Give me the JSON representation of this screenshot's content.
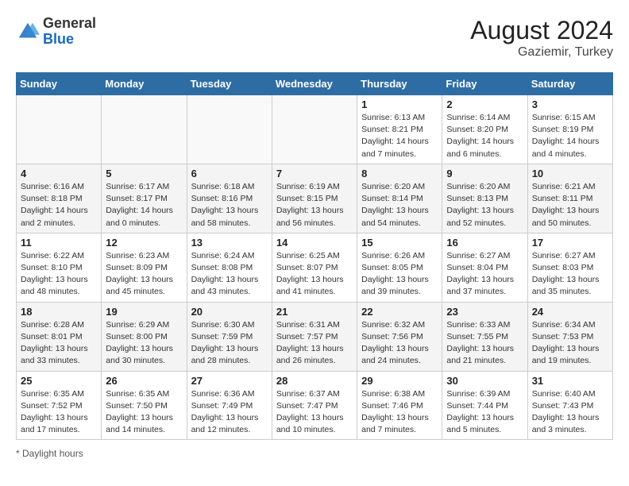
{
  "header": {
    "logo_line1": "General",
    "logo_line2": "Blue",
    "month_year": "August 2024",
    "location": "Gaziemir, Turkey"
  },
  "days_of_week": [
    "Sunday",
    "Monday",
    "Tuesday",
    "Wednesday",
    "Thursday",
    "Friday",
    "Saturday"
  ],
  "weeks": [
    [
      {
        "day": "",
        "info": ""
      },
      {
        "day": "",
        "info": ""
      },
      {
        "day": "",
        "info": ""
      },
      {
        "day": "",
        "info": ""
      },
      {
        "day": "1",
        "sunrise": "6:13 AM",
        "sunset": "8:21 PM",
        "daylight": "14 hours and 7 minutes."
      },
      {
        "day": "2",
        "sunrise": "6:14 AM",
        "sunset": "8:20 PM",
        "daylight": "14 hours and 6 minutes."
      },
      {
        "day": "3",
        "sunrise": "6:15 AM",
        "sunset": "8:19 PM",
        "daylight": "14 hours and 4 minutes."
      }
    ],
    [
      {
        "day": "4",
        "sunrise": "6:16 AM",
        "sunset": "8:18 PM",
        "daylight": "14 hours and 2 minutes."
      },
      {
        "day": "5",
        "sunrise": "6:17 AM",
        "sunset": "8:17 PM",
        "daylight": "14 hours and 0 minutes."
      },
      {
        "day": "6",
        "sunrise": "6:18 AM",
        "sunset": "8:16 PM",
        "daylight": "13 hours and 58 minutes."
      },
      {
        "day": "7",
        "sunrise": "6:19 AM",
        "sunset": "8:15 PM",
        "daylight": "13 hours and 56 minutes."
      },
      {
        "day": "8",
        "sunrise": "6:20 AM",
        "sunset": "8:14 PM",
        "daylight": "13 hours and 54 minutes."
      },
      {
        "day": "9",
        "sunrise": "6:20 AM",
        "sunset": "8:13 PM",
        "daylight": "13 hours and 52 minutes."
      },
      {
        "day": "10",
        "sunrise": "6:21 AM",
        "sunset": "8:11 PM",
        "daylight": "13 hours and 50 minutes."
      }
    ],
    [
      {
        "day": "11",
        "sunrise": "6:22 AM",
        "sunset": "8:10 PM",
        "daylight": "13 hours and 48 minutes."
      },
      {
        "day": "12",
        "sunrise": "6:23 AM",
        "sunset": "8:09 PM",
        "daylight": "13 hours and 45 minutes."
      },
      {
        "day": "13",
        "sunrise": "6:24 AM",
        "sunset": "8:08 PM",
        "daylight": "13 hours and 43 minutes."
      },
      {
        "day": "14",
        "sunrise": "6:25 AM",
        "sunset": "8:07 PM",
        "daylight": "13 hours and 41 minutes."
      },
      {
        "day": "15",
        "sunrise": "6:26 AM",
        "sunset": "8:05 PM",
        "daylight": "13 hours and 39 minutes."
      },
      {
        "day": "16",
        "sunrise": "6:27 AM",
        "sunset": "8:04 PM",
        "daylight": "13 hours and 37 minutes."
      },
      {
        "day": "17",
        "sunrise": "6:27 AM",
        "sunset": "8:03 PM",
        "daylight": "13 hours and 35 minutes."
      }
    ],
    [
      {
        "day": "18",
        "sunrise": "6:28 AM",
        "sunset": "8:01 PM",
        "daylight": "13 hours and 33 minutes."
      },
      {
        "day": "19",
        "sunrise": "6:29 AM",
        "sunset": "8:00 PM",
        "daylight": "13 hours and 30 minutes."
      },
      {
        "day": "20",
        "sunrise": "6:30 AM",
        "sunset": "7:59 PM",
        "daylight": "13 hours and 28 minutes."
      },
      {
        "day": "21",
        "sunrise": "6:31 AM",
        "sunset": "7:57 PM",
        "daylight": "13 hours and 26 minutes."
      },
      {
        "day": "22",
        "sunrise": "6:32 AM",
        "sunset": "7:56 PM",
        "daylight": "13 hours and 24 minutes."
      },
      {
        "day": "23",
        "sunrise": "6:33 AM",
        "sunset": "7:55 PM",
        "daylight": "13 hours and 21 minutes."
      },
      {
        "day": "24",
        "sunrise": "6:34 AM",
        "sunset": "7:53 PM",
        "daylight": "13 hours and 19 minutes."
      }
    ],
    [
      {
        "day": "25",
        "sunrise": "6:35 AM",
        "sunset": "7:52 PM",
        "daylight": "13 hours and 17 minutes."
      },
      {
        "day": "26",
        "sunrise": "6:35 AM",
        "sunset": "7:50 PM",
        "daylight": "13 hours and 14 minutes."
      },
      {
        "day": "27",
        "sunrise": "6:36 AM",
        "sunset": "7:49 PM",
        "daylight": "13 hours and 12 minutes."
      },
      {
        "day": "28",
        "sunrise": "6:37 AM",
        "sunset": "7:47 PM",
        "daylight": "13 hours and 10 minutes."
      },
      {
        "day": "29",
        "sunrise": "6:38 AM",
        "sunset": "7:46 PM",
        "daylight": "13 hours and 7 minutes."
      },
      {
        "day": "30",
        "sunrise": "6:39 AM",
        "sunset": "7:44 PM",
        "daylight": "13 hours and 5 minutes."
      },
      {
        "day": "31",
        "sunrise": "6:40 AM",
        "sunset": "7:43 PM",
        "daylight": "13 hours and 3 minutes."
      }
    ]
  ],
  "footer_note": "Daylight hours"
}
